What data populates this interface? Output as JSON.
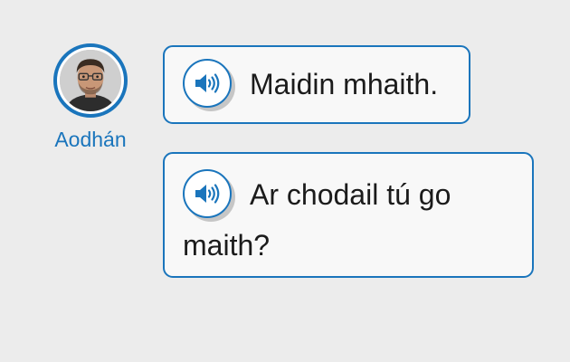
{
  "speaker": {
    "name": "Aodhán",
    "avatar_icon": "person-photo-avatar"
  },
  "messages": [
    {
      "text": "Maidin mhaith.",
      "audio_icon": "speaker-volume-icon"
    },
    {
      "text": "Ar chodail tú go maith?",
      "audio_icon": "speaker-volume-icon"
    }
  ],
  "colors": {
    "accent": "#1a75bc",
    "background": "#ececec",
    "bubble_fill": "#f8f8f8",
    "text": "#1b1b1b"
  }
}
